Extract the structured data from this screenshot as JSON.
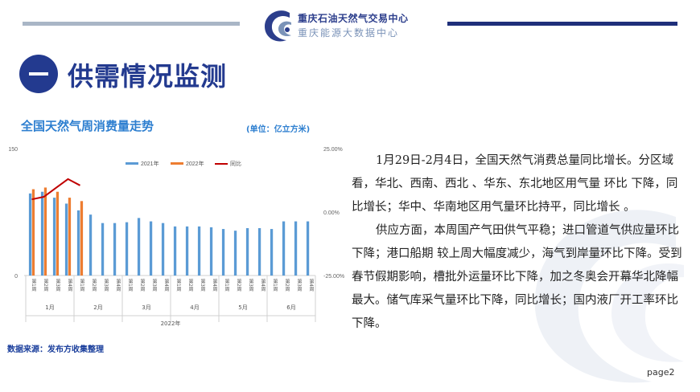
{
  "header": {
    "org_name": "重庆石油天然气交易中心",
    "org_sub": "重庆能源大数据中心",
    "colors": {
      "left_bar": "#a9b6c6",
      "right_bar": "#1f2f7a",
      "logo": "#2c3e8c"
    }
  },
  "section": {
    "title": "供需情况监测"
  },
  "chart_meta": {
    "unit": "(单位：亿立方米)",
    "source": "数据来源：发布方收集整理"
  },
  "chart_data": {
    "type": "bar",
    "title": "全国天然气周消费量走势",
    "categories": [
      "第1周",
      "第2周",
      "第3周",
      "第4周",
      "第1周",
      "第2周",
      "第3周",
      "第4周",
      "第1周",
      "第2周",
      "第3周",
      "第4周",
      "第1周",
      "第2周",
      "第3周",
      "第4周",
      "第1周",
      "第2周",
      "第3周",
      "第4周",
      "第1周",
      "第2周",
      "第3周",
      "第4周"
    ],
    "months": [
      "1月",
      "2月",
      "3月",
      "4月",
      "5月",
      "6月"
    ],
    "xgroup_label": "2022年",
    "series": [
      {
        "name": "2021年",
        "kind": "bar",
        "color": "#5b9bd5",
        "values": [
          97,
          99,
          92,
          85,
          77,
          72,
          62,
          62,
          63,
          68,
          64,
          62,
          58,
          58,
          58,
          57,
          55,
          53,
          56,
          56,
          55,
          64,
          64,
          64
        ]
      },
      {
        "name": "2022年",
        "kind": "bar",
        "color": "#ed7d31",
        "values": [
          102,
          104,
          99,
          92,
          88
        ]
      },
      {
        "name": "同比",
        "kind": "line",
        "axis": "right",
        "color": "#c00000",
        "values": [
          5.0,
          6.0,
          9.5,
          13.0,
          10.5
        ]
      }
    ],
    "ylim": [
      0,
      150
    ],
    "yticks": [
      "150",
      "0"
    ],
    "y2lim": [
      -25,
      25
    ],
    "y2ticks": [
      "25.00%",
      "0.00%",
      "-25.00%"
    ],
    "legend_position": "top"
  },
  "body": {
    "paragraphs": [
      "1月29日-2月4日，全国天然气消费总量同比增长。分区域看，华北、西南、西北 、华东、东北地区用气量 环比 下降，同比增长；华中、华南地区用气量环比持平，同比增长 。",
      "供应方面，本周国产气田供气平稳；进口管道气供应量环比下降；港口船期 较上周大幅度减少，海气到岸量环比下降。受到春节假期影响，槽批外运量环比下降，加之冬奥会开幕华北降幅最大。储气库采气量环比下降，同比增长；国内液厂开工率环比下降。"
    ]
  },
  "footer": {
    "page": "page2"
  }
}
